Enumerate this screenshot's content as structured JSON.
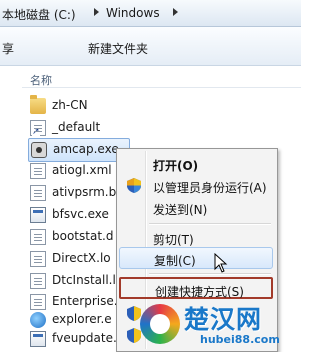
{
  "breadcrumb": {
    "drive": "本地磁盘 (C:)",
    "folder": "Windows"
  },
  "toolbar": {
    "share": "享",
    "new_folder": "新建文件夹"
  },
  "file_list": {
    "header_name": "名称",
    "files": [
      {
        "name": "zh-CN",
        "icon": "folder-icon"
      },
      {
        "name": "_default",
        "icon": "shortcut-icon"
      },
      {
        "name": "amcap.exe",
        "icon": "webcam-app-icon"
      },
      {
        "name": "atiogl.xml",
        "icon": "xml-file-icon"
      },
      {
        "name": "ativpsrm.b",
        "icon": "file-icon"
      },
      {
        "name": "bfsvc.exe",
        "icon": "app-icon"
      },
      {
        "name": "bootstat.d",
        "icon": "file-icon"
      },
      {
        "name": "DirectX.lo",
        "icon": "file-icon"
      },
      {
        "name": "DtcInstall.l",
        "icon": "file-icon"
      },
      {
        "name": "Enterprise.",
        "icon": "file-icon"
      },
      {
        "name": "explorer.e",
        "icon": "ie-icon"
      },
      {
        "name": "fveupdate.",
        "icon": "app-icon"
      }
    ]
  },
  "context_menu": {
    "items": [
      {
        "label": "打开(O)"
      },
      {
        "label": "以管理员身份运行(A)"
      },
      {
        "label": "发送到(N)"
      },
      {
        "label": "剪切(T)"
      },
      {
        "label": "复制(C)"
      },
      {
        "label": "创建快捷方式(S)"
      }
    ]
  },
  "watermark": {
    "title": "楚汉网",
    "url": "hubei88.com"
  },
  "colors": {
    "menu_outline": "#a23a2a",
    "watermark_blue": "#1a78c9"
  }
}
